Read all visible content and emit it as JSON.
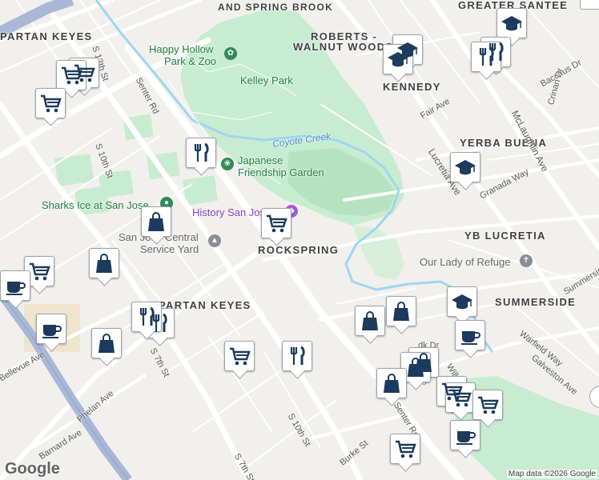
{
  "neighborhoods": {
    "greater_santee": "GREATER SANTEE",
    "spring_brook": "AND SPRING BROOK",
    "spartan_keyes_top": "PARTAN KEYES",
    "roberts_1": "ROBERTS -",
    "roberts_2": "WALNUT WOODS",
    "kennedy": "KENNEDY",
    "yerba_buena": "YERBA BUENA",
    "yb_lucretia": "YB LUCRETIA",
    "rockspring": "ROCKSPRING",
    "spartan_keyes_bottom": "PARTAN KEYES",
    "summerside": "SUMMERSIDE"
  },
  "places": {
    "happy_hollow_1": "Happy Hollow",
    "happy_hollow_2": "Park & Zoo",
    "kelley_park": "Kelley Park",
    "coyote_creek": "Coyote Creek",
    "japanese_1": "Japanese",
    "japanese_2": "Friendship Garden",
    "sharks_ice": "Sharks Ice at San Jose",
    "history": "History San José",
    "central_1": "San Jose Central",
    "central_2": "Service Yard",
    "lady_refuge": "Our Lady of Refuge"
  },
  "streets": {
    "s12th": "S 12th St",
    "s10th_top": "S 10th St",
    "senter_top": "Senter Rd",
    "senter_bottom": "Senter Rd",
    "s7th_mid": "S 7th St",
    "s10th_bottom": "S 10th St",
    "s7th_bottom": "S 7th St",
    "phelan": "Phelan Ave",
    "barnard": "Barnard Ave",
    "bellevue": "Bellevue Ave",
    "burke": "Burke St",
    "bacchus": "Bacchus Dr",
    "crinan": "Crinan Dr",
    "fair": "Fair Ave",
    "mclaughlin": "McLaughlin Ave",
    "lucretia": "Lucretia Ave",
    "granada": "Granada Way",
    "warfield": "Warfield Way",
    "galveston": "Galveston Ave",
    "summerside_dr": "Summerside",
    "willow": "Will",
    "dk_dr": "dk Dr"
  },
  "map_pins": [
    {
      "icon": "cart",
      "label": "grocery-cart-icon"
    },
    {
      "icon": "cart",
      "label": "grocery-cart-icon"
    },
    {
      "icon": "cart",
      "label": "grocery-cart-icon"
    },
    {
      "icon": "fork-knife",
      "label": "restaurant-icon"
    },
    {
      "icon": "bag",
      "label": "shopping-bag-icon"
    },
    {
      "icon": "cart",
      "label": "grocery-cart-icon"
    },
    {
      "icon": "bag",
      "label": "shopping-bag-icon"
    },
    {
      "icon": "cart",
      "label": "grocery-cart-icon"
    },
    {
      "icon": "coffee",
      "label": "coffee-cup-icon"
    },
    {
      "icon": "coffee",
      "label": "coffee-cup-icon"
    },
    {
      "icon": "fork-knife",
      "label": "restaurant-icon"
    },
    {
      "icon": "fork-knife",
      "label": "restaurant-icon"
    },
    {
      "icon": "bag",
      "label": "shopping-bag-icon"
    },
    {
      "icon": "cart",
      "label": "grocery-cart-icon"
    },
    {
      "icon": "fork-knife",
      "label": "restaurant-icon"
    },
    {
      "icon": "school",
      "label": "school-cap-icon"
    },
    {
      "icon": "school",
      "label": "school-cap-icon"
    },
    {
      "icon": "fork-knife",
      "label": "restaurant-icon"
    },
    {
      "icon": "fork-knife",
      "label": "restaurant-icon"
    },
    {
      "icon": "school",
      "label": "school-cap-icon"
    },
    {
      "icon": "school",
      "label": "school-cap-icon"
    },
    {
      "icon": "school",
      "label": "school-cap-icon"
    },
    {
      "icon": "bag",
      "label": "shopping-bag-icon"
    },
    {
      "icon": "bag",
      "label": "shopping-bag-icon"
    },
    {
      "icon": "coffee",
      "label": "coffee-cup-icon"
    },
    {
      "icon": "bag",
      "label": "shopping-bag-icon"
    },
    {
      "icon": "bag",
      "label": "shopping-bag-icon"
    },
    {
      "icon": "bag",
      "label": "shopping-bag-icon"
    },
    {
      "icon": "cart",
      "label": "grocery-cart-icon"
    },
    {
      "icon": "cart",
      "label": "grocery-cart-icon"
    },
    {
      "icon": "cart",
      "label": "grocery-cart-icon"
    },
    {
      "icon": "coffee",
      "label": "coffee-cup-icon"
    },
    {
      "icon": "cart",
      "label": "grocery-cart-icon"
    }
  ],
  "google_logo": "Google",
  "attribution": "Map data ©2026 Google",
  "colors": {
    "map_background": "#f2f0ec",
    "park_green": "#c8ecd0",
    "water_blue": "#9fd6f0",
    "road_white": "#ffffff",
    "highway_blue": "#a9b8d6",
    "pin_icon_navy": "#1b3a5c"
  }
}
